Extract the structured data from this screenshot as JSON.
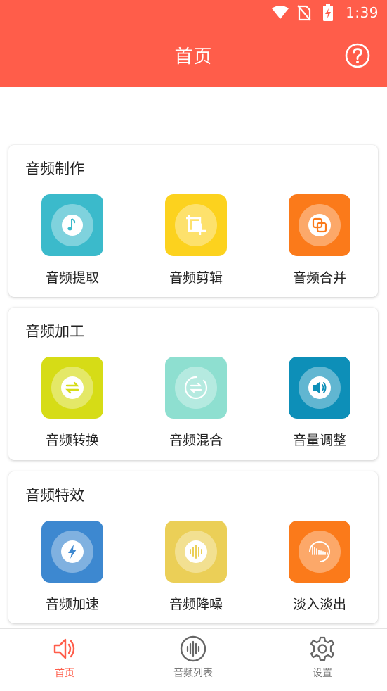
{
  "status_bar": {
    "time": "1:39"
  },
  "app_bar": {
    "title": "首页"
  },
  "sections": [
    {
      "title": "音频制作",
      "items": [
        {
          "label": "音频提取",
          "icon": "music-note-icon",
          "color": "#3bbacb"
        },
        {
          "label": "音频剪辑",
          "icon": "crop-icon",
          "color": "#fcd21e"
        },
        {
          "label": "音频合并",
          "icon": "merge-icon",
          "color": "#fb7a1a"
        }
      ]
    },
    {
      "title": "音频加工",
      "items": [
        {
          "label": "音频转换",
          "icon": "swap-icon",
          "color": "#d6dc16"
        },
        {
          "label": "音频混合",
          "icon": "mix-icon",
          "color": "#8edfd0"
        },
        {
          "label": "音量调整",
          "icon": "volume-icon",
          "color": "#0d8fb8"
        }
      ]
    },
    {
      "title": "音频特效",
      "items": [
        {
          "label": "音频加速",
          "icon": "lightning-icon",
          "color": "#3d88d0"
        },
        {
          "label": "音频降噪",
          "icon": "waveform-icon",
          "color": "#ebcf57"
        },
        {
          "label": "淡入淡出",
          "icon": "fade-icon",
          "color": "#fb7a1a"
        }
      ]
    }
  ],
  "bottom_nav": [
    {
      "label": "首页",
      "icon": "speaker-icon",
      "active": true
    },
    {
      "label": "音频列表",
      "icon": "audio-list-icon",
      "active": false
    },
    {
      "label": "设置",
      "icon": "gear-icon",
      "active": false
    }
  ],
  "colors": {
    "primary": "#ff5d4a",
    "inactive": "#777777"
  }
}
